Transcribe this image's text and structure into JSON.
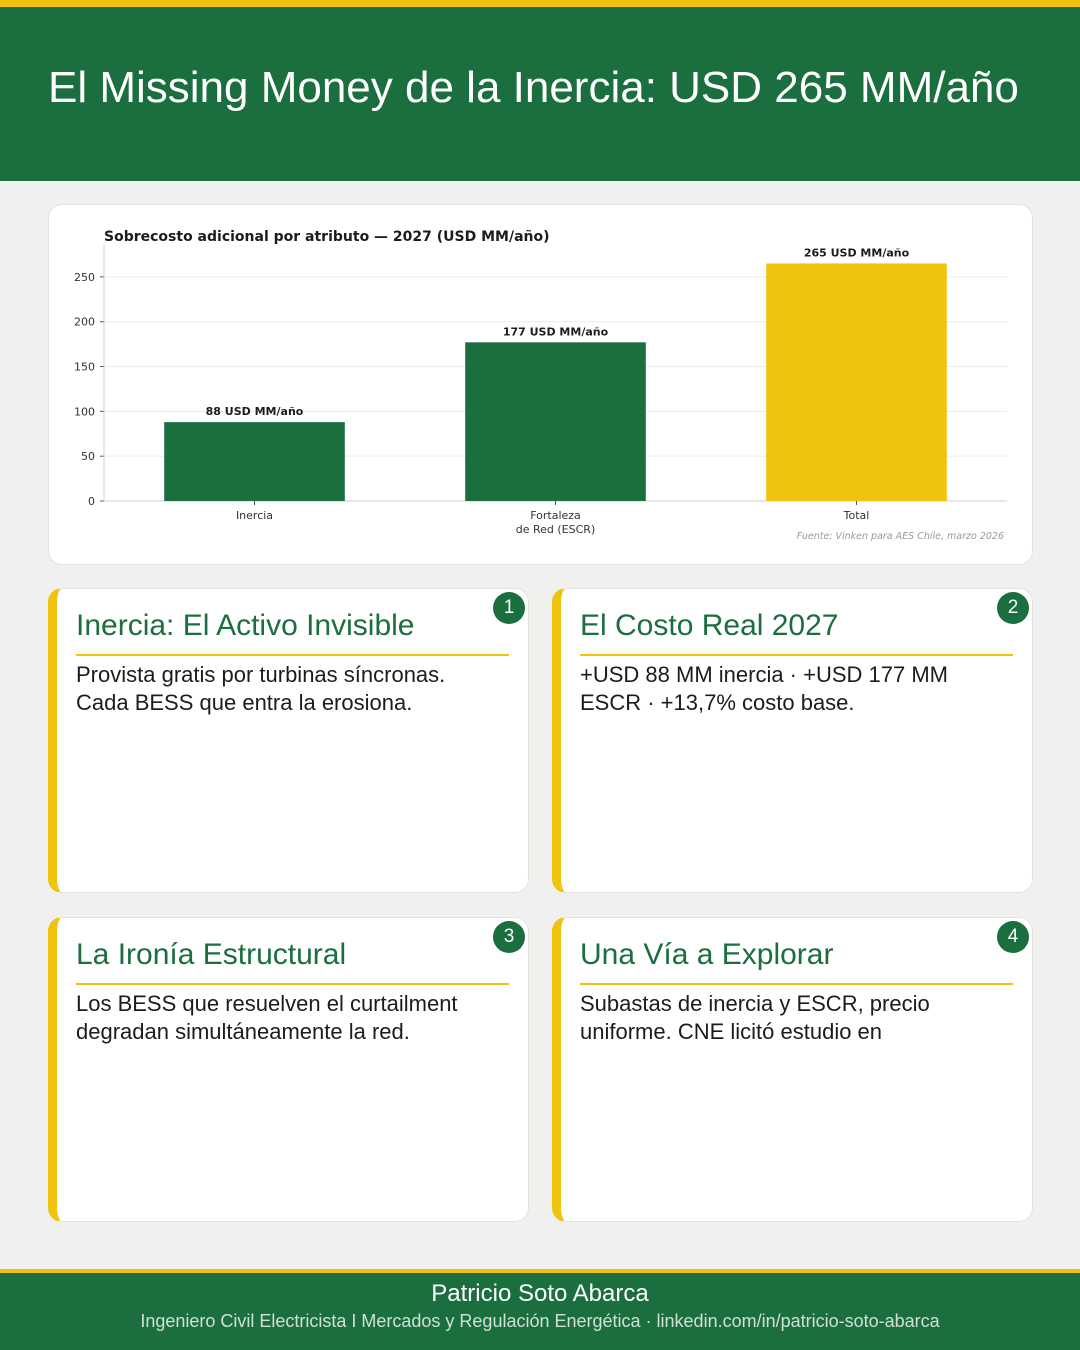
{
  "header": {
    "title": "El Missing Money de la Inercia: USD 265 MM/año"
  },
  "chart_data": {
    "type": "bar",
    "title": "Sobrecosto adicional por atributo — 2027 (USD MM/año)",
    "categories": [
      "Inercia",
      "Fortaleza\nde Red (ESCR)",
      "Total"
    ],
    "values": [
      88,
      177,
      265
    ],
    "data_labels": [
      "88 USD MM/año",
      "177 USD MM/año",
      "265 USD MM/año"
    ],
    "colors": [
      "#1b6e3e",
      "#1b6e3e",
      "#f0c30f"
    ],
    "yticks": [
      0,
      50,
      100,
      150,
      200,
      250
    ],
    "ylim": [
      0,
      280
    ],
    "grid": true,
    "source": "Fuente: Vinken para AES Chile, marzo 2026"
  },
  "cards": [
    {
      "number": "1",
      "title": "Inercia: El Activo Invisible",
      "text": "Provista gratis por turbinas síncronas. Cada BESS que entra la erosiona."
    },
    {
      "number": "2",
      "title": "El Costo Real 2027",
      "text": "+USD 88 MM inercia · +USD 177 MM ESCR · +13,7% costo base."
    },
    {
      "number": "3",
      "title": "La Ironía Estructural",
      "text": "Los BESS que resuelven el curtailment degradan simultáneamente la red."
    },
    {
      "number": "4",
      "title": "Una Vía a Explorar",
      "text": "Subastas de inercia y ESCR, precio uniforme. CNE licitó estudio en"
    }
  ],
  "footer": {
    "name": "Patricio Soto Abarca",
    "subtitle": "Ingeniero Civil Electricista I Mercados y Regulación Energética  ·  linkedin.com/in/patricio-soto-abarca"
  }
}
